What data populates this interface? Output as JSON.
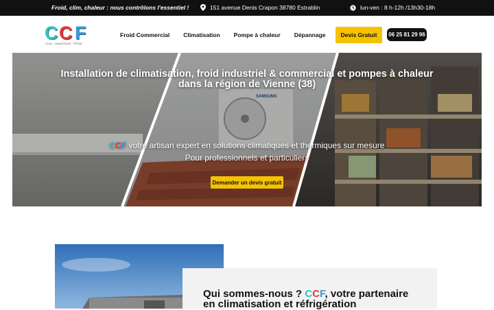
{
  "topbar": {
    "slogan": "Froid, clim, chaleur : nous contrôlons l'essentiel !",
    "address": "151 avenue Denis Crapon 38780 Estrablin",
    "hours": "lun-ven : 8 h-12h /13h30-18h",
    "address_icon": "map-pin-icon",
    "hours_icon": "clock-icon"
  },
  "header": {
    "logo_letters": [
      "C",
      "C",
      "F"
    ],
    "logo_sub": "CLIM · CHAUFFAGE · FROID",
    "nav": {
      "froid": "Froid Commercial",
      "clim": "Climatisation",
      "pompe": "Pompe à chaleur",
      "depannage": "Dépannage"
    },
    "cta": "Devis Gratuit",
    "phone": "06 25 81 29 96"
  },
  "hero": {
    "title_line1": "Installation de climatisation, froid industriel & commercial et pompes à chaleur",
    "title_line2": "dans la région de Vienne (38)",
    "brand": [
      "C",
      "C",
      "F"
    ],
    "tagline_rest": " votre artisan expert en solutions climatiques et thermiques sur mesure",
    "tagline_line2": "Pour professionnels et particuliers",
    "cta": "Demander un devis gratuit",
    "unit_brand": "SAMSUNG"
  },
  "about": {
    "heading_pre": "Qui sommes-nous ? ",
    "brand": [
      "C",
      "C",
      "F"
    ],
    "heading_post": ", votre partenaire",
    "heading_line2": "en climatisation et réfrigération"
  },
  "colors": {
    "accent_yellow": "#f5c200",
    "brand_teal": "#35c3c0",
    "brand_red": "#e23a3a",
    "brand_blue": "#3a9ad9",
    "topbar_bg": "#111111"
  }
}
